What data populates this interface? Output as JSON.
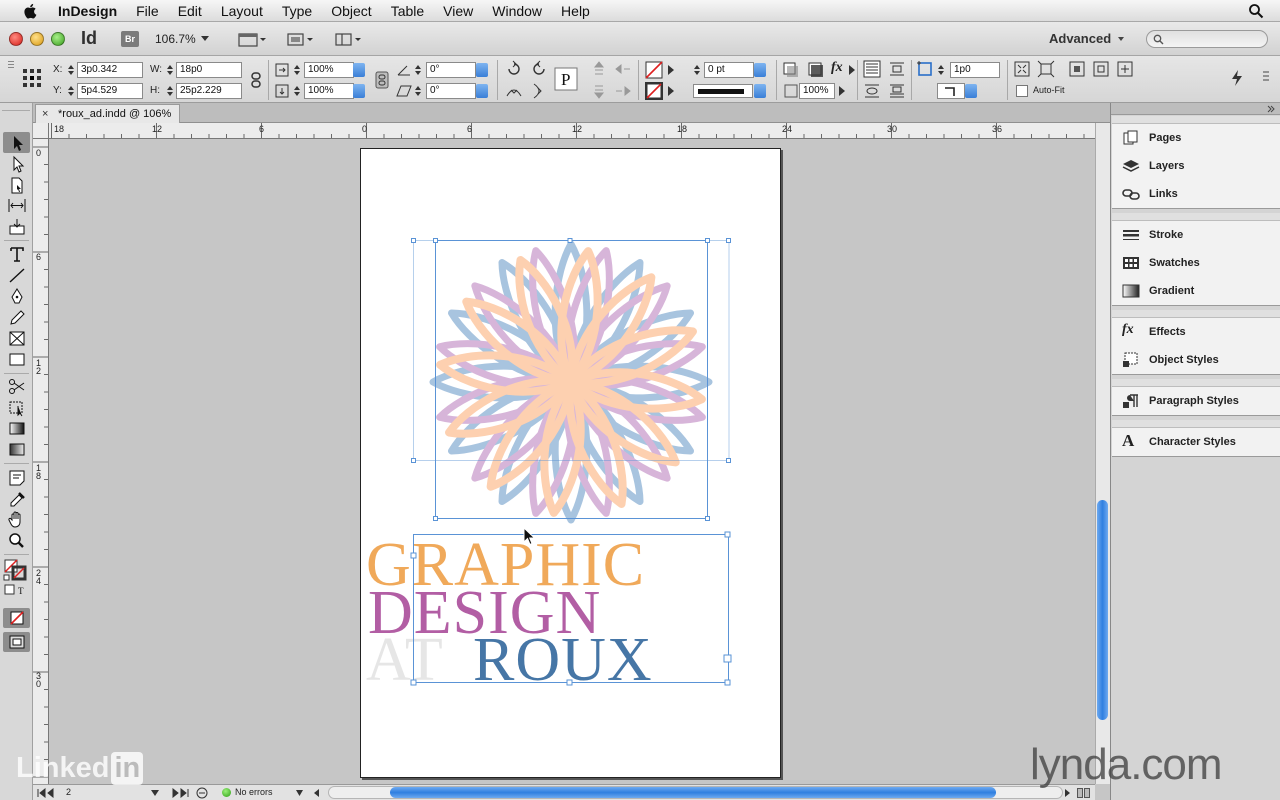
{
  "menubar": {
    "items": [
      "InDesign",
      "File",
      "Edit",
      "Layout",
      "Type",
      "Object",
      "Table",
      "View",
      "Window",
      "Help"
    ]
  },
  "appbar": {
    "app_logo": "Id",
    "bridge": "Br",
    "zoom": "106.7%",
    "workspace": "Advanced"
  },
  "control": {
    "x_label": "X:",
    "x_value": "3p0.342",
    "y_label": "Y:",
    "y_value": "5p4.529",
    "w_label": "W:",
    "w_value": "18p0",
    "h_label": "H:",
    "h_value": "25p2.229",
    "scale_x": "100%",
    "scale_y": "100%",
    "rotate": "0°",
    "shear": "0°",
    "stroke_weight": "0 pt",
    "opacity": "100%",
    "fitting_gap": "1p0",
    "auto_fit": "Auto-Fit"
  },
  "document": {
    "tab": "*roux_ad.indd @ 106%",
    "headline": {
      "line1": "GRAPHIC",
      "line2": "DESIGN",
      "line3a": "AT",
      "line3b": "ROUX"
    }
  },
  "ruler": {
    "h_labels": [
      "18",
      "12",
      "6",
      "0",
      "6",
      "12",
      "18",
      "24",
      "30",
      "36"
    ],
    "v_labels": [
      "0",
      "6",
      "1 2",
      "1 8",
      "2 4",
      "3 0"
    ]
  },
  "panels": {
    "group1": [
      "Pages",
      "Layers",
      "Links"
    ],
    "group2": [
      "Stroke",
      "Swatches",
      "Gradient"
    ],
    "group3": [
      "Effects",
      "Object Styles"
    ],
    "group4": [
      "Paragraph Styles"
    ],
    "group5": [
      "Character Styles"
    ]
  },
  "status": {
    "page": "2",
    "preflight": "No errors"
  },
  "watermarks": {
    "left": "Linked",
    "left_badge": "in",
    "right": "lynda.com"
  },
  "colors": {
    "headline_orange": "#f0a95a",
    "headline_purple": "#b25ea4",
    "headline_blue": "#4676a6",
    "headline_grey": "#e6e6e6",
    "petal_blue": "#a8c4df",
    "petal_purple": "#d7b5d9",
    "petal_orange": "#fdd0b0",
    "selection": "#5a93d6"
  }
}
